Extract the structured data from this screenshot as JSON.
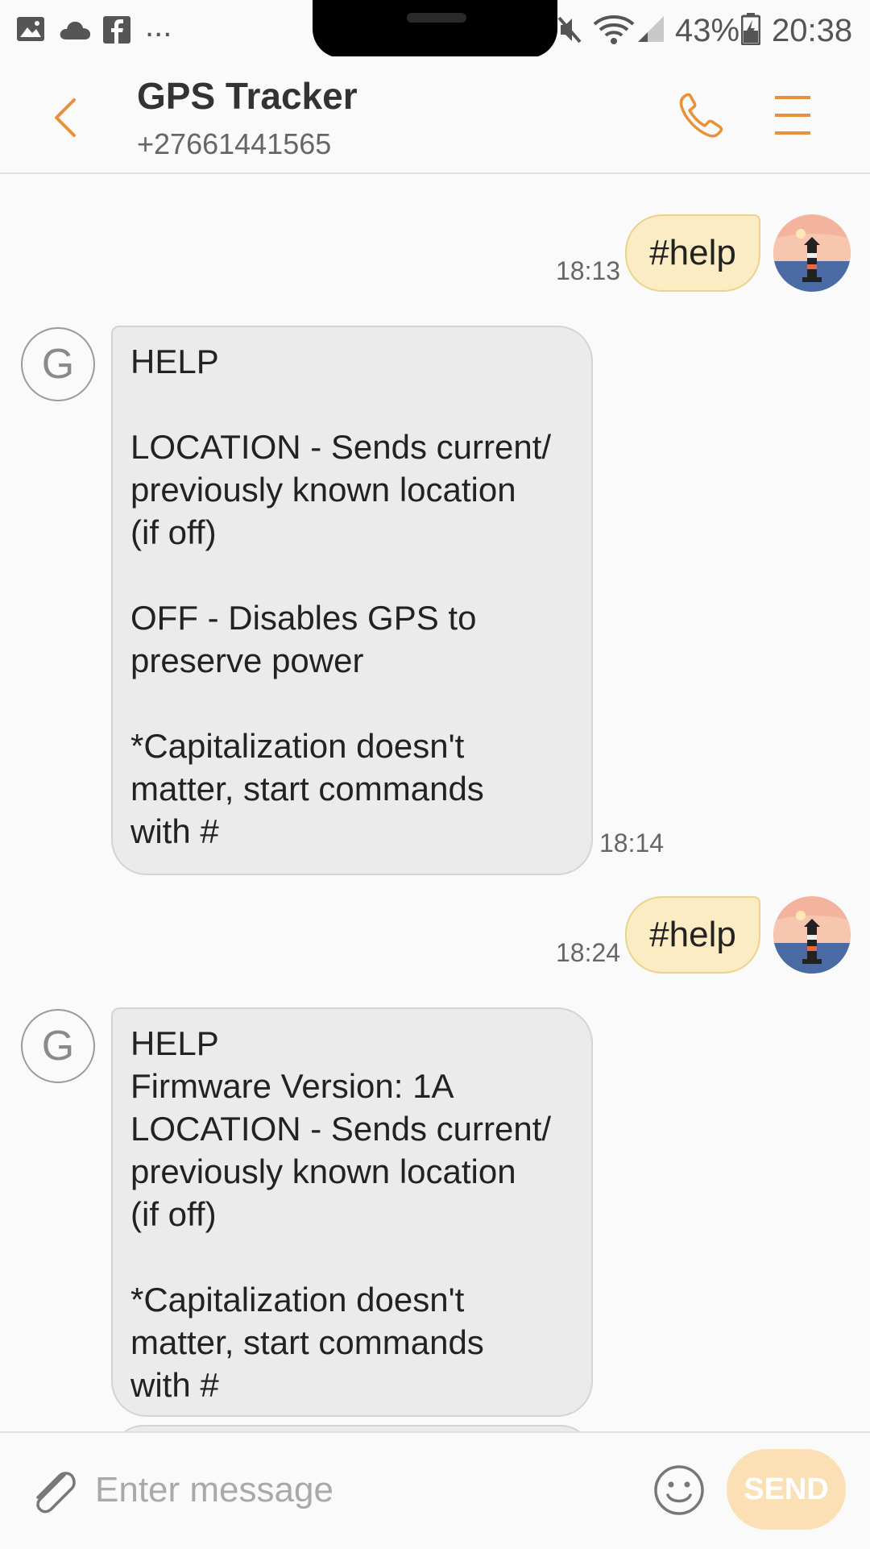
{
  "status_bar": {
    "notification_icons": [
      "image-icon",
      "cloud-icon",
      "facebook-icon"
    ],
    "more_indicator": "...",
    "battery": "43%",
    "time": "20:38"
  },
  "header": {
    "title": "GPS Tracker",
    "subtitle": "+27661441565",
    "icons": [
      "back-arrow-icon",
      "phone-icon",
      "menu-icon"
    ]
  },
  "messages": [
    {
      "direction": "outgoing",
      "text": "#help",
      "time": "18:13"
    },
    {
      "direction": "incoming",
      "avatar_letter": "G",
      "text": "HELP\n\nLOCATION - Sends current/\npreviously known location\n(if off)\n\nOFF - Disables GPS to\npreserve power\n\n*Capitalization doesn't\nmatter, start commands\nwith #",
      "time": "18:14"
    },
    {
      "direction": "outgoing",
      "text": "#help",
      "time": "18:24"
    },
    {
      "direction": "incoming",
      "avatar_letter": "G",
      "text": "HELP\nFirmware Version: 1A\nLOCATION - Sends current/\npreviously known location\n(if off)\n\n*Capitalization doesn't\nmatter, start commands\nwith #"
    }
  ],
  "composer": {
    "placeholder": "Enter message",
    "send_label": "SEND",
    "icons": [
      "attachment-icon",
      "emoji-icon"
    ]
  },
  "colors": {
    "accent": "#e8913a",
    "outgoing_bubble": "#fcecc3",
    "incoming_bubble": "#ebebeb",
    "send_button": "#fbe0b5"
  }
}
